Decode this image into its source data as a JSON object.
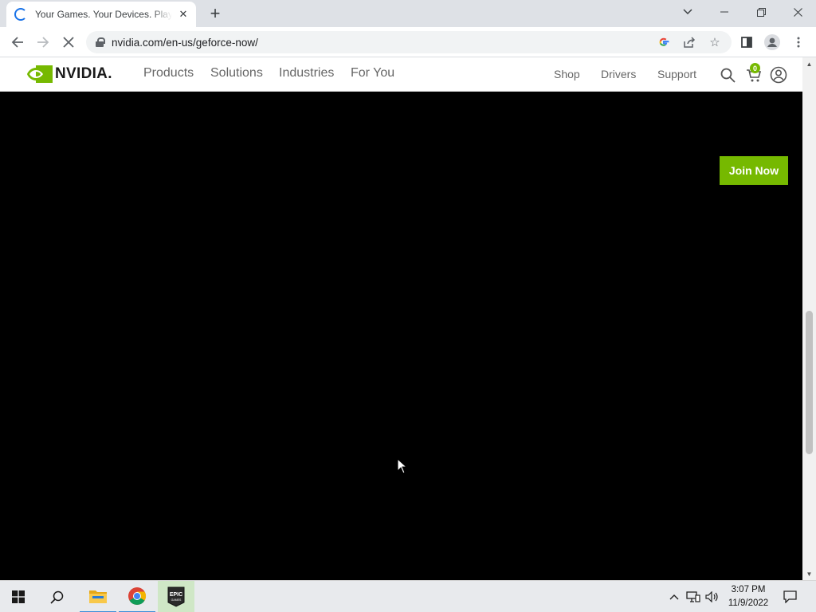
{
  "browser": {
    "tab_title": "Your Games. Your Devices. Play Anywhere",
    "url": "nvidia.com/en-us/geforce-now/",
    "icons": {
      "tab_loading": "loading-spinner-icon",
      "tab_close": "close-icon",
      "new_tab": "plus-icon",
      "tab_search": "chevron-down-icon",
      "minimize": "minimize-icon",
      "restore": "restore-icon",
      "close_window": "close-icon",
      "back": "back-arrow-icon",
      "forward": "forward-arrow-icon",
      "stop": "stop-icon",
      "lock": "lock-icon",
      "google": "google-icon",
      "share": "share-icon",
      "bookmark": "star-icon",
      "side_panel": "side-panel-icon",
      "profile": "profile-icon",
      "menu": "kebab-menu-icon"
    }
  },
  "site": {
    "logo_text": "NVIDIA.",
    "main_nav": [
      "Products",
      "Solutions",
      "Industries",
      "For You"
    ],
    "secondary_nav": [
      "Shop",
      "Drivers",
      "Support"
    ],
    "cart_count": "0",
    "join_button": "Join Now",
    "colors": {
      "brand_green": "#76b900",
      "hero_bg": "#000000"
    }
  },
  "taskbar": {
    "apps": [
      "start-icon",
      "search-icon",
      "file-explorer-icon",
      "chrome-icon",
      "epic-games-icon"
    ],
    "epic_label": "EPIC",
    "epic_sublabel": "GAMES",
    "time": "3:07 PM",
    "date": "11/9/2022"
  }
}
